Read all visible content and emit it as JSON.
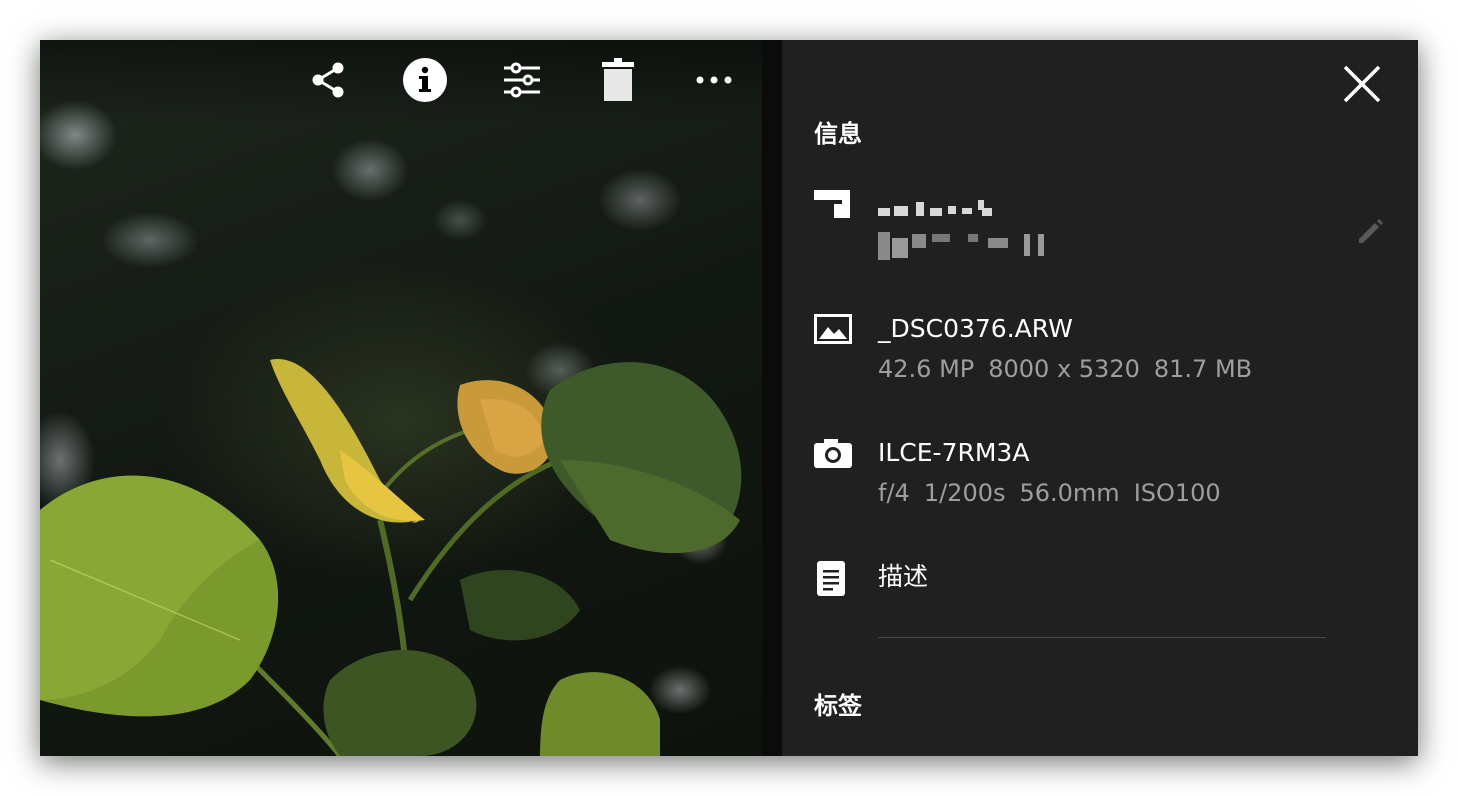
{
  "toolbar": {
    "icons": [
      "share-icon",
      "info-icon",
      "adjust-icon",
      "delete-icon",
      "more-icon"
    ]
  },
  "panel": {
    "info_title": "信息",
    "tags_title": "标签",
    "file": {
      "name": "_DSC0376.ARW",
      "details": [
        "42.6 MP",
        "8000 x 5320",
        "81.7 MB"
      ]
    },
    "camera": {
      "model": "ILCE-7RM3A",
      "settings": [
        "f/4",
        "1/200s",
        "56.0mm",
        "ISO100"
      ]
    },
    "description_label": "描述"
  },
  "colors": {
    "panel_bg": "#202020",
    "primary_text": "#ffffff",
    "secondary_text": "#9e9e9e",
    "divider": "#4a4a4a"
  }
}
